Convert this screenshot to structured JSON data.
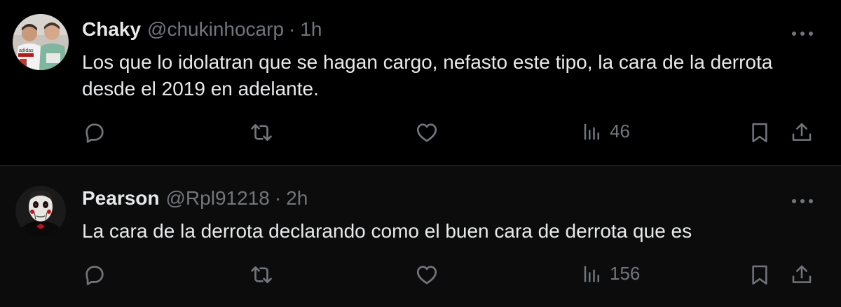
{
  "tweets": [
    {
      "name": "Chaky",
      "handle": "@chukinhocarp",
      "separator": "·",
      "time": "1h",
      "text": "Los que lo idolatran que se hagan cargo, nefasto este tipo, la cara de la derrota desde el 2019 en adelante.",
      "views": "46"
    },
    {
      "name": "Pearson",
      "handle": "@Rpl91218",
      "separator": "·",
      "time": "2h",
      "text": "La cara de la derrota declarando como el buen cara de derrota que es",
      "views": "156"
    }
  ],
  "colors": {
    "background": "#000000",
    "second_background": "#0c0c0c",
    "primary_text": "#e7e9ea",
    "secondary_text": "#71767b",
    "divider": "#2f3336"
  },
  "icons": [
    "reply-icon",
    "retweet-icon",
    "like-icon",
    "views-icon",
    "bookmark-icon",
    "share-icon",
    "more-icon"
  ]
}
